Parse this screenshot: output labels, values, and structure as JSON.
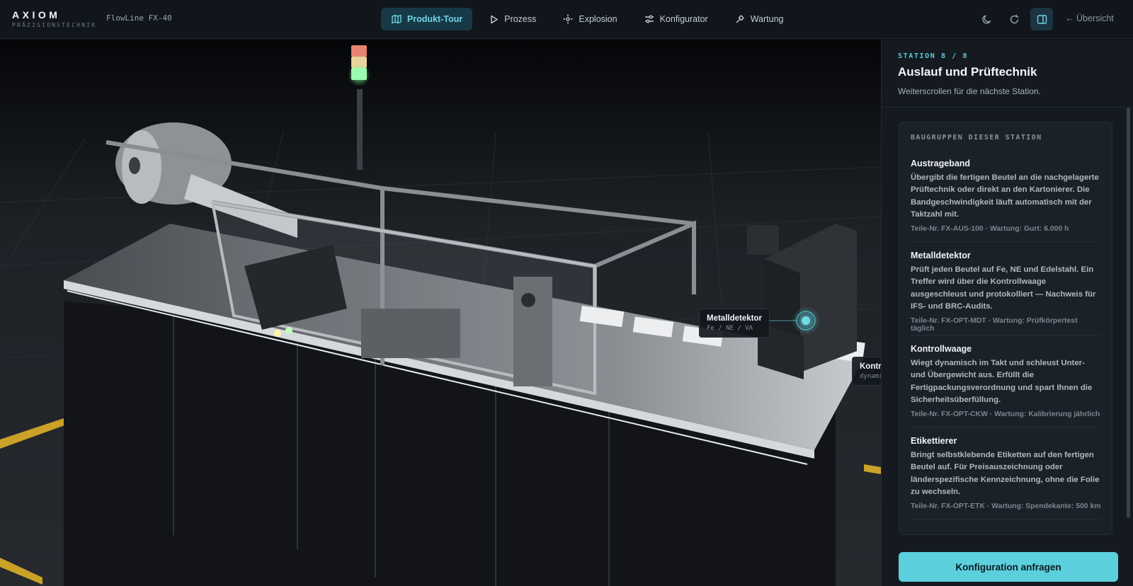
{
  "brand": {
    "name": "AXIOM",
    "subtitle": "PRÄZISIONSTECHNIK",
    "model": "FlowLine FX-40"
  },
  "nav": {
    "items": [
      {
        "label": "Produkt-Tour",
        "icon": "map-icon",
        "active": true
      },
      {
        "label": "Prozess",
        "icon": "play-icon",
        "active": false
      },
      {
        "label": "Explosion",
        "icon": "explode-icon",
        "active": false
      },
      {
        "label": "Konfigurator",
        "icon": "sliders-icon",
        "active": false
      },
      {
        "label": "Wartung",
        "icon": "wrench-icon",
        "active": false
      }
    ]
  },
  "toolbar": {
    "icons": [
      "moon-icon",
      "refresh-icon",
      "panel-toggle-icon"
    ],
    "back_label": "← Übersicht"
  },
  "scene": {
    "hotspots": [
      {
        "title": "Metalldetektor",
        "sub": "Fe / NE / VA"
      },
      {
        "title": "Kontrollwaage",
        "sub": "dynamisch"
      }
    ]
  },
  "panel": {
    "station_label": "STATION 8 / 8",
    "title": "Auslauf und Prüftechnik",
    "hint": "Weiterscrollen für die nächste Station.",
    "card_title": "BAUGRUPPEN DIESER STATION",
    "modules": [
      {
        "name": "Austrageband",
        "desc": "Übergibt die fertigen Beutel an die nachgelagerte Prüftechnik oder direkt an den Kartonierer. Die Bandgeschwindigkeit läuft automatisch mit der Taktzahl mit.",
        "meta": "Teile-Nr. FX-AUS-100 · Wartung: Gurt: 6.000 h"
      },
      {
        "name": "Metalldetektor",
        "desc": "Prüft jeden Beutel auf Fe, NE und Edelstahl. Ein Treffer wird über die Kontrollwaage ausgeschleust und protokolliert — Nachweis für IFS- und BRC-Audits.",
        "meta": "Teile-Nr. FX-OPT-MDT · Wartung: Prüfkörpertest täglich"
      },
      {
        "name": "Kontrollwaage",
        "desc": "Wiegt dynamisch im Takt und schleust Unter- und Übergewicht aus. Erfüllt die Fertigpackungsverordnung und spart Ihnen die Sicherheitsüberfüllung.",
        "meta": "Teile-Nr. FX-OPT-CKW · Wartung: Kalibrierung jährlich"
      },
      {
        "name": "Etikettierer",
        "desc": "Bringt selbstklebende Etiketten auf den fertigen Beutel auf. Für Preisauszeichnung oder länderspezifische Kennzeichnung, ohne die Folie zu wechseln.",
        "meta": "Teile-Nr. FX-OPT-ETK · Wartung: Spendekante: 500 km"
      }
    ],
    "cta_label": "Konfiguration anfragen"
  },
  "colors": {
    "accent": "#5ccfdd",
    "background": "#0d1116",
    "panel": "#141a20",
    "floor_stripe": "#c9a227"
  }
}
